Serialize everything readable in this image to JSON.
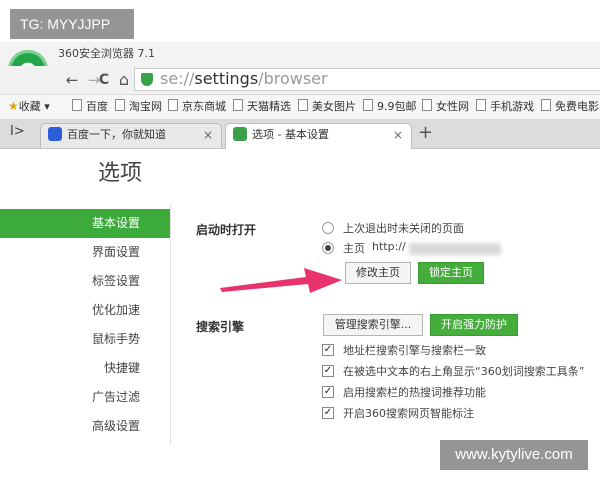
{
  "watermark": {
    "top": "TG: MYYJJPP",
    "bottom": "www.kytylive.com"
  },
  "app": {
    "title": "360安全浏览器 7.1",
    "logo_glyph": "e"
  },
  "nav": {
    "back_glyph": "←",
    "forward_glyph": "→",
    "reload_glyph": "C",
    "home_glyph": "⌂",
    "url_prefix": "se://",
    "url_main": "settings",
    "url_suffix": "/browser"
  },
  "bookmarks": {
    "favorites_label": "收藏",
    "items": [
      "百度",
      "淘宝网",
      "京东商城",
      "天猫精选",
      "美女图片",
      "9.9包邮",
      "女性网",
      "手机游戏",
      "免费电影"
    ]
  },
  "tabs": {
    "side_glyph": "I>",
    "items": [
      {
        "label": "百度一下，你就知道",
        "icon": "baidu-paw-icon",
        "icon_color": "#2b5fd9"
      },
      {
        "label": "选项 - 基本设置",
        "icon": "wrench-icon",
        "icon_color": "#3aa34a"
      }
    ],
    "close_glyph": "×",
    "new_tab_glyph": "+"
  },
  "page": {
    "title": "选项"
  },
  "sidebar": {
    "items": [
      {
        "label": "基本设置",
        "active": true
      },
      {
        "label": "界面设置",
        "active": false
      },
      {
        "label": "标签设置",
        "active": false
      },
      {
        "label": "优化加速",
        "active": false
      },
      {
        "label": "鼠标手势",
        "active": false
      },
      {
        "label": "快捷键",
        "active": false
      },
      {
        "label": "广告过滤",
        "active": false
      },
      {
        "label": "高级设置",
        "active": false
      }
    ]
  },
  "startup": {
    "heading": "启动时打开",
    "option_last": "上次退出时未关闭的页面",
    "option_home": "主页",
    "home_url": "http://",
    "modify_button": "修改主页",
    "lock_button": "锁定主页"
  },
  "search": {
    "heading": "搜索引擎",
    "manage_button": "管理搜索引擎...",
    "protect_button": "开启强力防护",
    "checkboxes": [
      "地址栏搜索引擎与搜索栏一致",
      "在被选中文本的右上角显示“360划词搜索工具条”",
      "启用搜索栏的热搜词推荐功能",
      "开启360搜索网页智能标注"
    ]
  },
  "colors": {
    "accent": "#3cab3c",
    "arrow": "#e8336c"
  }
}
